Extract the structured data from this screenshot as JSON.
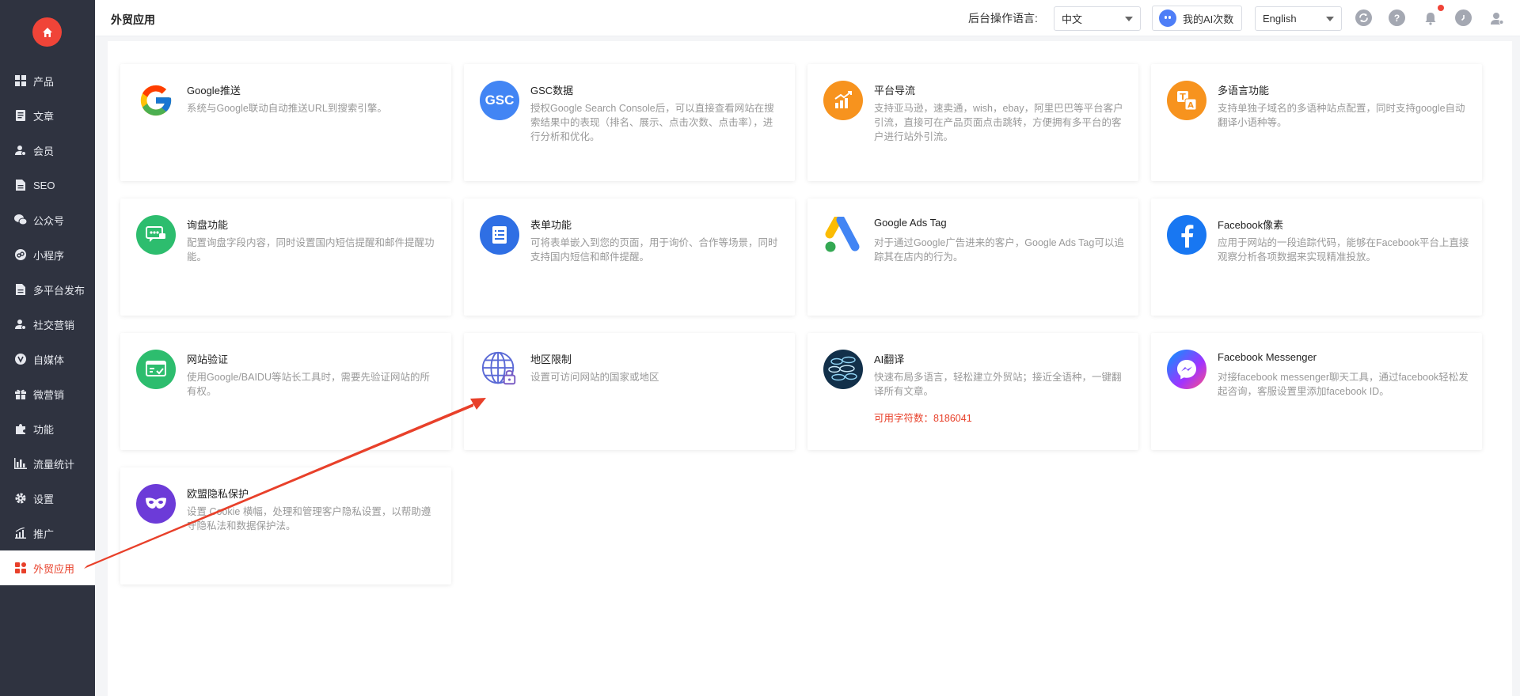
{
  "sidebar": {
    "home_icon": "home-icon",
    "items": [
      {
        "label": "产品",
        "icon": "grid-icon"
      },
      {
        "label": "文章",
        "icon": "document-icon"
      },
      {
        "label": "会员",
        "icon": "user-icon"
      },
      {
        "label": "SEO",
        "icon": "file-icon"
      },
      {
        "label": "公众号",
        "icon": "wechat-icon"
      },
      {
        "label": "小程序",
        "icon": "miniprogram-icon"
      },
      {
        "label": "多平台发布",
        "icon": "file-icon"
      },
      {
        "label": "社交营销",
        "icon": "user-icon"
      },
      {
        "label": "自媒体",
        "icon": "media-icon"
      },
      {
        "label": "微营销",
        "icon": "gift-icon"
      },
      {
        "label": "功能",
        "icon": "puzzle-icon"
      },
      {
        "label": "流量统计",
        "icon": "bar-chart-icon"
      },
      {
        "label": "设置",
        "icon": "gear-icon"
      },
      {
        "label": "推广",
        "icon": "trend-icon"
      },
      {
        "label": "外贸应用",
        "icon": "apps-icon",
        "active": true
      }
    ]
  },
  "header": {
    "title": "外贸应用",
    "lang_label": "后台操作语言:",
    "lang_select": "中文",
    "ai_button": "我的AI次数",
    "ui_lang_select": "English"
  },
  "cards": [
    {
      "title": "Google推送",
      "desc": "系统与Google联动自动推送URL到搜索引擎。",
      "icon": "google-icon"
    },
    {
      "title": "GSC数据",
      "desc": "授权Google Search Console后，可以直接查看网站在搜索结果中的表现（排名、展示、点击次数、点击率），进行分析和优化。",
      "icon": "gsc-icon",
      "logo_text": "GSC"
    },
    {
      "title": "平台导流",
      "desc": "支持亚马逊，速卖通，wish，ebay，阿里巴巴等平台客户引流，直接可在产品页面点击跳转，方便拥有多平台的客户进行站外引流。",
      "icon": "platform-traffic-icon"
    },
    {
      "title": "多语言功能",
      "desc": "支持单独子域名的多语种站点配置，同时支持google自动翻译小语种等。",
      "icon": "translate-icon"
    },
    {
      "title": "询盘功能",
      "desc": "配置询盘字段内容，同时设置国内短信提醒和邮件提醒功能。",
      "icon": "inquiry-icon"
    },
    {
      "title": "表单功能",
      "desc": "可将表单嵌入到您的页面，用于询价、合作等场景，同时支持国内短信和邮件提醒。",
      "icon": "form-icon"
    },
    {
      "title": "Google Ads Tag",
      "desc": "对于通过Google广告进来的客户，Google Ads Tag可以追踪其在店内的行为。",
      "icon": "google-ads-icon"
    },
    {
      "title": "Facebook像素",
      "desc": "应用于网站的一段追踪代码，能够在Facebook平台上直接观察分析各项数据来实现精准投放。",
      "icon": "facebook-icon"
    },
    {
      "title": "网站验证",
      "desc": "使用Google/BAIDU等站长工具时，需要先验证网站的所有权。",
      "icon": "verify-icon"
    },
    {
      "title": "地区限制",
      "desc": "设置可访问网站的国家或地区",
      "icon": "globe-lock-icon"
    },
    {
      "title": "AI翻译",
      "desc": "快速布局多语言，轻松建立外贸站；接近全语种，一键翻译所有文章。",
      "icon": "ai-translate-icon",
      "extra": "可用字符数：8186041"
    },
    {
      "title": "Facebook Messenger",
      "desc": "对接facebook messenger聊天工具，通过facebook轻松发起咨询，客服设置里添加facebook ID。",
      "icon": "messenger-icon"
    },
    {
      "title": "欧盟隐私保护",
      "desc": "设置 Cookie 横幅，处理和管理客户隐私设置，以帮助遵守隐私法和数据保护法。",
      "icon": "mask-icon"
    }
  ],
  "colors": {
    "sidebar_bg": "#2f3340",
    "accent": "#e8402a",
    "gsc_blue": "#4285f4",
    "orange": "#f7931e",
    "green": "#2dbd6e",
    "facebook_blue": "#1877f2",
    "purple": "#6c3bd8"
  }
}
